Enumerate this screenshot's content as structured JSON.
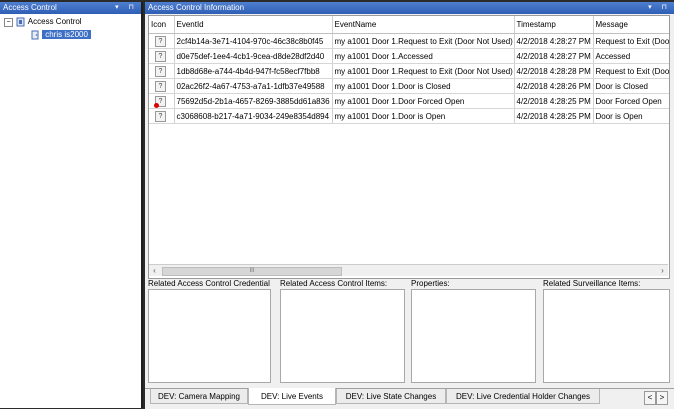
{
  "left_panel": {
    "title": "Access Control",
    "title_buttons": "▾ ⊓",
    "tree": {
      "root": {
        "expander": "−",
        "label": "Access Control"
      },
      "child": {
        "label": "chris is2000"
      }
    }
  },
  "right_panel": {
    "title": "Access Control Information",
    "title_buttons": "▾ ⊓",
    "grid": {
      "columns": [
        "Icon",
        "EventId",
        "EventName",
        "Timestamp",
        "Message"
      ],
      "rows": [
        {
          "icon": "?",
          "event_id": "2cf4b14a-3e71-4104-970c-46c38c8b0f45",
          "event_name": "my a1001 Door 1.Request to Exit (Door Not Used)",
          "timestamp": "4/2/2018 4:28:27 PM",
          "message": "Request to Exit (Door"
        },
        {
          "icon": "?",
          "event_id": "d0e75def-1ee4-4cb1-9cea-d8de28df2d40",
          "event_name": "my a1001 Door 1.Accessed",
          "timestamp": "4/2/2018 4:28:27 PM",
          "message": "Accessed"
        },
        {
          "icon": "?",
          "event_id": "1db8d68e-a744-4b4d-947f-fc58ecf7fbb8",
          "event_name": "my a1001 Door 1.Request to Exit (Door Not Used)",
          "timestamp": "4/2/2018 4:28:28 PM",
          "message": "Request to Exit (Door"
        },
        {
          "icon": "?",
          "event_id": "02ac26f2-4a67-4753-a7a1-1dfb37e49588",
          "event_name": "my a1001 Door 1.Door is Closed",
          "timestamp": "4/2/2018 4:28:26 PM",
          "message": "Door is Closed"
        },
        {
          "icon": "?",
          "alarm": true,
          "event_id": "75692d5d-2b1a-4657-8269-3885dd61a836",
          "event_name": "my a1001 Door 1.Door Forced Open",
          "timestamp": "4/2/2018 4:28:25 PM",
          "message": "Door Forced Open"
        },
        {
          "icon": "?",
          "event_id": "c3068608-b217-4a71-9034-249e8354d894",
          "event_name": "my a1001 Door 1.Door is Open",
          "timestamp": "4/2/2018 4:28:25 PM",
          "message": "Door is Open"
        }
      ]
    },
    "scrollbar": {
      "left": "‹",
      "right": "›",
      "thumb": "III"
    },
    "panels": [
      {
        "label": "Related Access Control Credential"
      },
      {
        "label": "Related Access Control Items:"
      },
      {
        "label": "Properties:"
      },
      {
        "label": "Related Surveillance Items:"
      }
    ],
    "tabs": [
      {
        "label": "DEV: Camera Mapping"
      },
      {
        "label": "DEV: Live Events",
        "active": true
      },
      {
        "label": "DEV: Live State Changes"
      },
      {
        "label": "DEV: Live Credential Holder Changes"
      }
    ],
    "tab_nav": {
      "prev": "<",
      "next": ">"
    }
  }
}
